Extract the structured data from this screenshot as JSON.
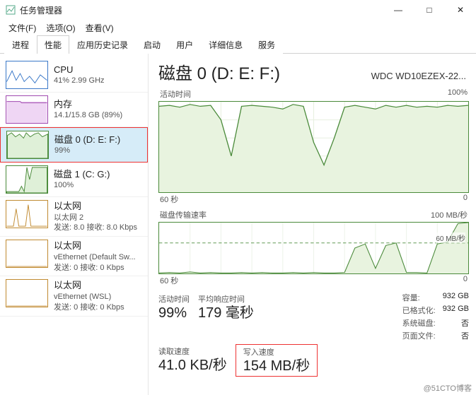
{
  "window": {
    "title": "任务管理器",
    "min": "—",
    "max": "□",
    "close": "✕"
  },
  "menu": {
    "file": "文件(F)",
    "options": "选项(O)",
    "view": "查看(V)"
  },
  "tabs": {
    "t0": "进程",
    "t1": "性能",
    "t2": "应用历史记录",
    "t3": "启动",
    "t4": "用户",
    "t5": "详细信息",
    "t6": "服务"
  },
  "sidebar": {
    "cpu": {
      "h": "CPU",
      "s": "41%  2.99 GHz"
    },
    "mem": {
      "h": "内存",
      "s": "14.1/15.8 GB (89%)"
    },
    "disk0": {
      "h": "磁盘 0 (D: E: F:)",
      "s": "99%"
    },
    "disk1": {
      "h": "磁盘 1 (C: G:)",
      "s": "100%"
    },
    "eth0": {
      "h": "以太网",
      "n": "以太网 2",
      "s": "发送: 8.0  接收: 8.0 Kbps"
    },
    "eth1": {
      "h": "以太网",
      "n": "vEthernet (Default Sw...",
      "s": "发送: 0  接收: 0 Kbps"
    },
    "eth2": {
      "h": "以太网",
      "n": "vEthernet (WSL)",
      "s": "发送: 0  接收: 0 Kbps"
    }
  },
  "main": {
    "title": "磁盘 0 (D: E: F:)",
    "model": "WDC WD10EZEX-22...",
    "graph1_label": "活动时间",
    "graph1_max": "100%",
    "graph2_label": "磁盘传输速率",
    "graph2_max": "100 MB/秒",
    "graph2_dash": "60 MB/秒",
    "axis_left": "60 秒",
    "axis_right": "0",
    "stats": {
      "active_lbl": "活动时间",
      "active_val": "99%",
      "resp_lbl": "平均响应时间",
      "resp_val": "179 毫秒",
      "read_lbl": "读取速度",
      "read_val": "41.0 KB/秒",
      "write_lbl": "写入速度",
      "write_val": "154 MB/秒"
    },
    "meta": {
      "cap_l": "容量:",
      "cap_v": "932 GB",
      "fmt_l": "已格式化:",
      "fmt_v": "932 GB",
      "sys_l": "系统磁盘:",
      "sys_v": "否",
      "page_l": "页面文件:",
      "page_v": "否"
    }
  },
  "chart_data": [
    {
      "type": "area",
      "title": "活动时间",
      "ylabel": "%",
      "ylim": [
        0,
        100
      ],
      "xlabel": "秒",
      "xlim_label": [
        "60 秒",
        "0"
      ],
      "values": [
        95,
        96,
        94,
        97,
        95,
        96,
        80,
        40,
        95,
        96,
        95,
        94,
        92,
        97,
        95,
        55,
        30,
        60,
        94,
        96,
        94,
        92,
        96,
        94,
        96,
        94,
        95,
        94,
        96,
        95,
        96
      ]
    },
    {
      "type": "line",
      "title": "磁盘传输速率",
      "ylabel": "MB/秒",
      "ylim": [
        0,
        100
      ],
      "dashed_ref": 60,
      "xlabel": "秒",
      "xlim_label": [
        "60 秒",
        "0"
      ],
      "series": [
        {
          "name": "读取速度",
          "values": [
            0,
            0,
            0,
            0,
            0,
            0,
            0,
            0,
            0,
            0,
            0,
            0,
            0,
            0,
            0,
            0,
            0,
            0,
            0,
            0,
            0,
            0,
            0,
            0,
            0,
            0,
            0,
            0,
            0,
            0,
            0.04
          ]
        },
        {
          "name": "写入速度",
          "values": [
            1,
            2,
            1,
            3,
            1,
            2,
            1,
            1,
            2,
            1,
            2,
            1,
            1,
            2,
            1,
            2,
            1,
            1,
            2,
            50,
            58,
            10,
            55,
            60,
            2,
            2,
            1,
            58,
            62,
            98,
            154
          ]
        }
      ]
    }
  ],
  "watermark": "@51CTO博客"
}
